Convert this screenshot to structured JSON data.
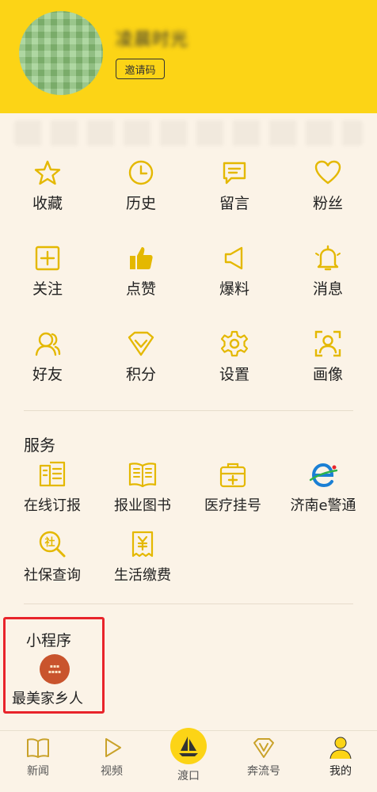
{
  "profile": {
    "username": "凌晨时光",
    "invite_label": "邀请码"
  },
  "colors": {
    "accent": "#fcd416",
    "icon_gold": "#e4b800",
    "background": "#fbf3e7",
    "highlight_border": "#e8242b"
  },
  "grid": [
    {
      "label": "收藏",
      "icon": "star-icon"
    },
    {
      "label": "历史",
      "icon": "clock-icon"
    },
    {
      "label": "留言",
      "icon": "message-icon"
    },
    {
      "label": "粉丝",
      "icon": "heart-icon"
    },
    {
      "label": "关注",
      "icon": "plus-square-icon"
    },
    {
      "label": "点赞",
      "icon": "thumbs-up-icon"
    },
    {
      "label": "爆料",
      "icon": "megaphone-icon"
    },
    {
      "label": "消息",
      "icon": "bell-icon"
    },
    {
      "label": "好友",
      "icon": "friends-icon"
    },
    {
      "label": "积分",
      "icon": "diamond-icon"
    },
    {
      "label": "设置",
      "icon": "gear-icon"
    },
    {
      "label": "画像",
      "icon": "face-scan-icon"
    }
  ],
  "services": {
    "title": "服务",
    "items": [
      {
        "label": "在线订报",
        "icon": "newspaper-icon"
      },
      {
        "label": "报业图书",
        "icon": "book-icon"
      },
      {
        "label": "医疗挂号",
        "icon": "medical-kit-icon"
      },
      {
        "label": "济南e警通",
        "icon": "police-e-logo-icon"
      },
      {
        "label": "社保查询",
        "icon": "social-security-search-icon"
      },
      {
        "label": "生活缴费",
        "icon": "bill-payment-icon"
      }
    ]
  },
  "mini_programs": {
    "title": "小程序",
    "items": [
      {
        "label": "最美家乡人",
        "icon": "hometown-logo-icon"
      }
    ]
  },
  "tabbar": [
    {
      "label": "新闻",
      "icon": "book-open-icon"
    },
    {
      "label": "视频",
      "icon": "play-icon"
    },
    {
      "label": "渡口",
      "icon": "sailboat-icon"
    },
    {
      "label": "奔流号",
      "icon": "v-badge-icon"
    },
    {
      "label": "我的",
      "icon": "person-icon",
      "active": true
    }
  ]
}
